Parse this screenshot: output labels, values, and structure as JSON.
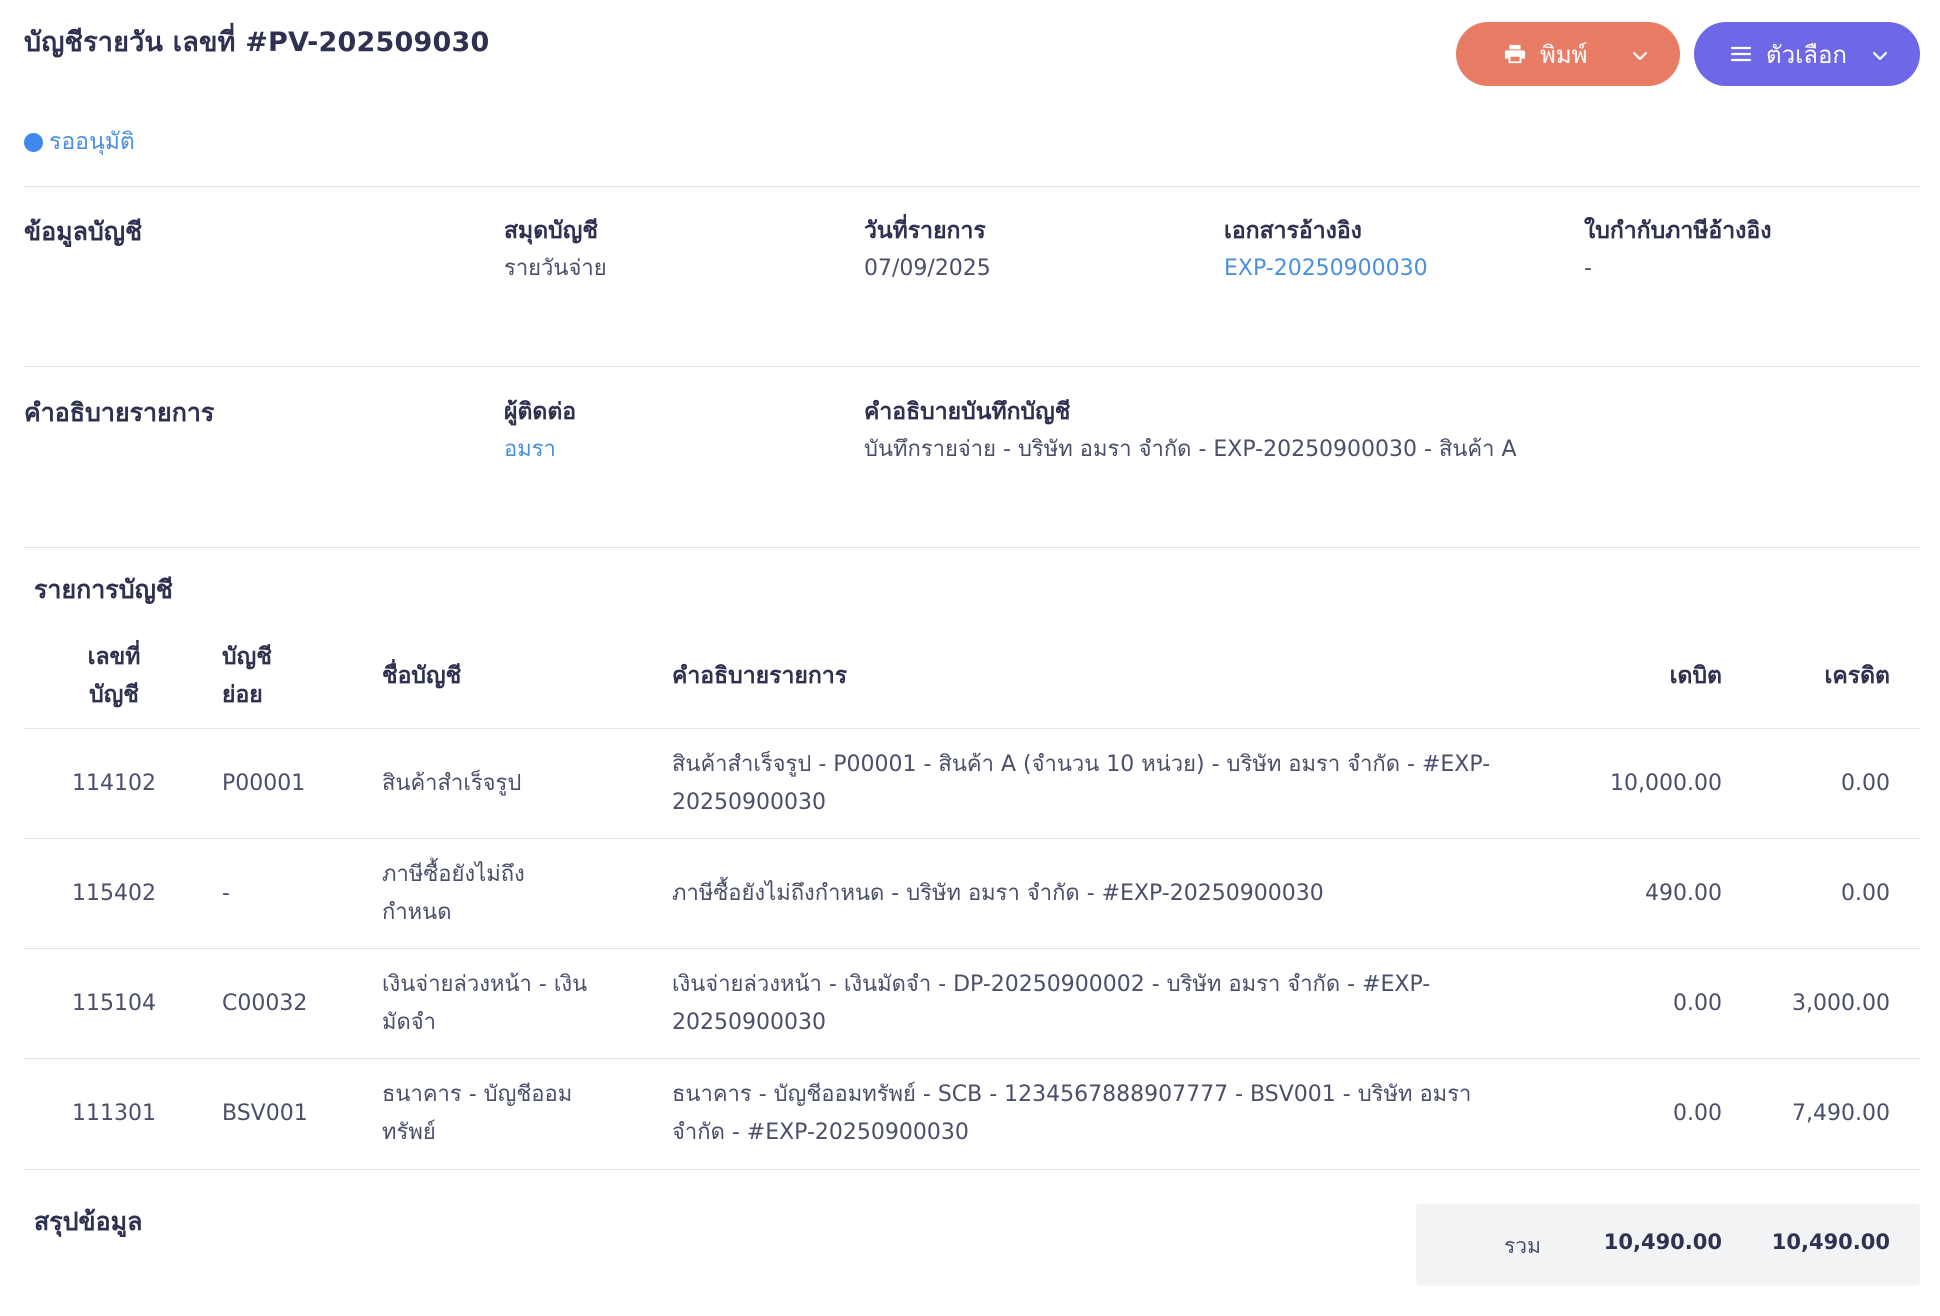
{
  "header": {
    "title": "บัญชีรายวัน เลขที่ #PV-202509030",
    "status": "รออนุมัติ",
    "print_label": "พิมพ์",
    "options_label": "ตัวเลือก"
  },
  "account_info": {
    "section_title": "ข้อมูลบัญชี",
    "book_label": "สมุดบัญชี",
    "book_value": "รายวันจ่าย",
    "date_label": "วันที่รายการ",
    "date_value": "07/09/2025",
    "ref_doc_label": "เอกสารอ้างอิง",
    "ref_doc_value": "EXP-20250900030",
    "tax_ref_label": "ใบกำกับภาษีอ้างอิง",
    "tax_ref_value": "-"
  },
  "description": {
    "section_title": "คำอธิบายรายการ",
    "contact_label": "ผู้ติดต่อ",
    "contact_value": "อมรา",
    "note_label": "คำอธิบายบันทึกบัญชี",
    "note_value": "บันทึกรายจ่าย - บริษัท อมรา จำกัด - EXP-20250900030 - สินค้า A"
  },
  "entries": {
    "section_title": "รายการบัญชี",
    "columns": {
      "account_no_1": "เลขที่",
      "account_no_2": "บัญชี",
      "sub_account_1": "บัญชี",
      "sub_account_2": "ย่อย",
      "account_name": "ชื่อบัญชี",
      "description": "คำอธิบายรายการ",
      "debit": "เดบิต",
      "credit": "เครดิต"
    },
    "rows": [
      {
        "account_no": "114102",
        "sub_account": "P00001",
        "name_1": "สินค้าสำเร็จรูป",
        "name_2": "",
        "desc_1": "สินค้าสำเร็จรูป - P00001 - สินค้า A (จำนวน 10 หน่วย) - บริษัท อมรา จำกัด - #EXP-",
        "desc_2": "20250900030",
        "debit": "10,000.00",
        "credit": "0.00"
      },
      {
        "account_no": "115402",
        "sub_account": "-",
        "name_1": "ภาษีซื้อยังไม่ถึง",
        "name_2": "กำหนด",
        "desc_1": "ภาษีซื้อยังไม่ถึงกำหนด - บริษัท อมรา จำกัด - #EXP-20250900030",
        "desc_2": "",
        "debit": "490.00",
        "credit": "0.00"
      },
      {
        "account_no": "115104",
        "sub_account": "C00032",
        "name_1": "เงินจ่ายล่วงหน้า - เงิน",
        "name_2": "มัดจำ",
        "desc_1": "เงินจ่ายล่วงหน้า - เงินมัดจำ - DP-20250900002 - บริษัท อมรา จำกัด - #EXP-",
        "desc_2": "20250900030",
        "debit": "0.00",
        "credit": "3,000.00"
      },
      {
        "account_no": "111301",
        "sub_account": "BSV001",
        "name_1": "ธนาคาร - บัญชีออม",
        "name_2": "ทรัพย์",
        "desc_1": "ธนาคาร - บัญชีออมทรัพย์ - SCB - 1234567888907777 - BSV001 - บริษัท อมรา",
        "desc_2": "จำกัด - #EXP-20250900030",
        "debit": "0.00",
        "credit": "7,490.00"
      }
    ]
  },
  "summary": {
    "section_title": "สรุปข้อมูล",
    "total_label": "รวม",
    "total_debit": "10,490.00",
    "total_credit": "10,490.00"
  },
  "colors": {
    "print_button": "#e97c65",
    "options_button": "#6f68e6",
    "status_dot": "#3f88ee",
    "link": "#4a8fe0"
  },
  "icons": [
    "printer-icon",
    "menu-icon",
    "chevron-down-icon"
  ]
}
